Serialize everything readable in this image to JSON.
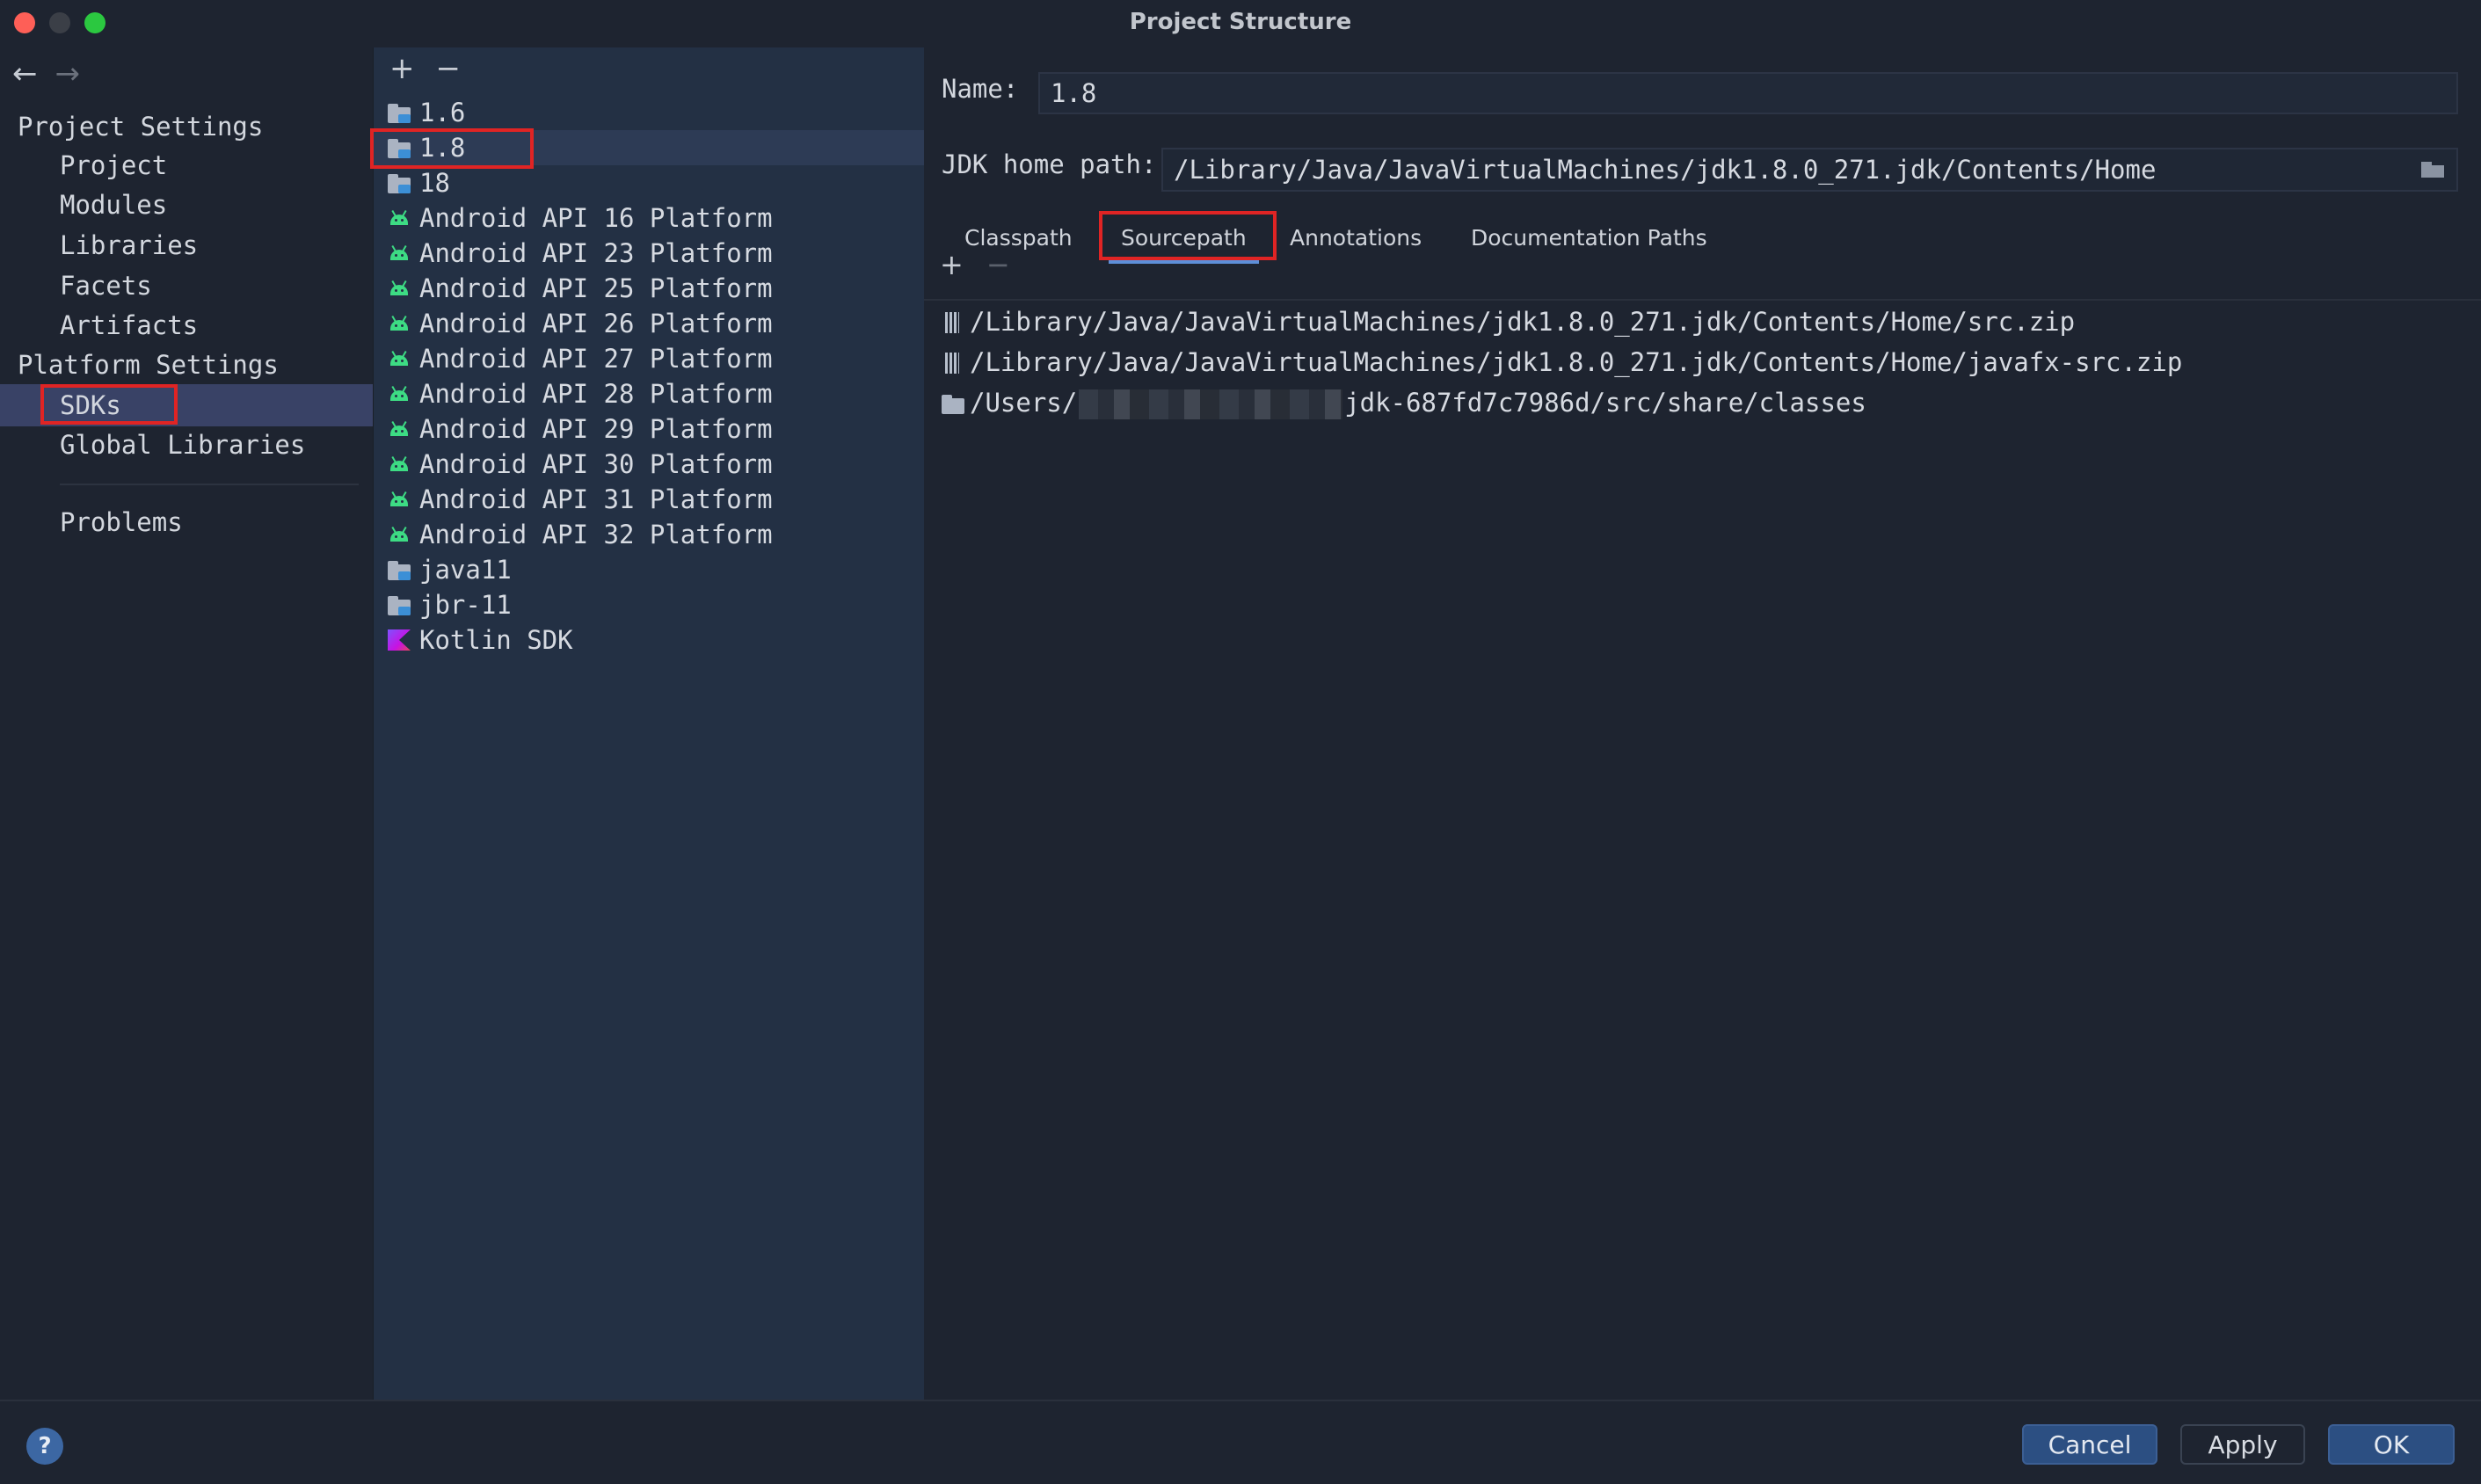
{
  "window": {
    "title": "Project Structure"
  },
  "nav": {
    "back_icon": "arrow-left-icon",
    "forward_icon": "arrow-right-icon",
    "project_settings_label": "Project Settings",
    "project_settings_items": [
      "Project",
      "Modules",
      "Libraries",
      "Facets",
      "Artifacts"
    ],
    "platform_settings_label": "Platform Settings",
    "platform_settings_items": [
      "SDKs",
      "Global Libraries"
    ],
    "selected_item": "SDKs",
    "problems_label": "Problems"
  },
  "sdk_list": {
    "add_label": "+",
    "remove_label": "−",
    "items": [
      {
        "label": "1.6",
        "icon": "jdk-folder-icon"
      },
      {
        "label": "1.8",
        "icon": "jdk-folder-icon"
      },
      {
        "label": "18",
        "icon": "jdk-folder-icon"
      },
      {
        "label": "Android API 16 Platform",
        "icon": "android-icon"
      },
      {
        "label": "Android API 23 Platform",
        "icon": "android-icon"
      },
      {
        "label": "Android API 25 Platform",
        "icon": "android-icon"
      },
      {
        "label": "Android API 26 Platform",
        "icon": "android-icon"
      },
      {
        "label": "Android API 27 Platform",
        "icon": "android-icon"
      },
      {
        "label": "Android API 28 Platform",
        "icon": "android-icon"
      },
      {
        "label": "Android API 29 Platform",
        "icon": "android-icon"
      },
      {
        "label": "Android API 30 Platform",
        "icon": "android-icon"
      },
      {
        "label": "Android API 31 Platform",
        "icon": "android-icon"
      },
      {
        "label": "Android API 32 Platform",
        "icon": "android-icon"
      },
      {
        "label": "java11",
        "icon": "jdk-folder-icon"
      },
      {
        "label": "jbr-11",
        "icon": "jdk-folder-icon"
      },
      {
        "label": "Kotlin SDK",
        "icon": "kotlin-icon"
      }
    ],
    "selected_item": "1.8"
  },
  "detail": {
    "name_label": "Name:",
    "name_value": "1.8",
    "jdk_home_label": "JDK home path:",
    "jdk_home_value": "/Library/Java/JavaVirtualMachines/jdk1.8.0_271.jdk/Contents/Home",
    "tabs": [
      "Classpath",
      "Sourcepath",
      "Annotations",
      "Documentation Paths"
    ],
    "active_tab": "Sourcepath",
    "paths_add_label": "+",
    "paths_remove_label": "−",
    "paths": [
      {
        "icon": "jar-icon",
        "text": "/Library/Java/JavaVirtualMachines/jdk1.8.0_271.jdk/Contents/Home/src.zip"
      },
      {
        "icon": "jar-icon",
        "text": "/Library/Java/JavaVirtualMachines/jdk1.8.0_271.jdk/Contents/Home/javafx-src.zip"
      },
      {
        "icon": "folder-icon",
        "text_prefix": "/Users/",
        "text_suffix": "jdk-687fd7c7986d/src/share/classes"
      }
    ]
  },
  "footer": {
    "help_label": "?",
    "cancel_label": "Cancel",
    "apply_label": "Apply",
    "ok_label": "OK"
  },
  "colors": {
    "highlight": "#e02424",
    "selection": "#394266",
    "primary_button": "#2c4f82",
    "android": "#3ddc84"
  }
}
